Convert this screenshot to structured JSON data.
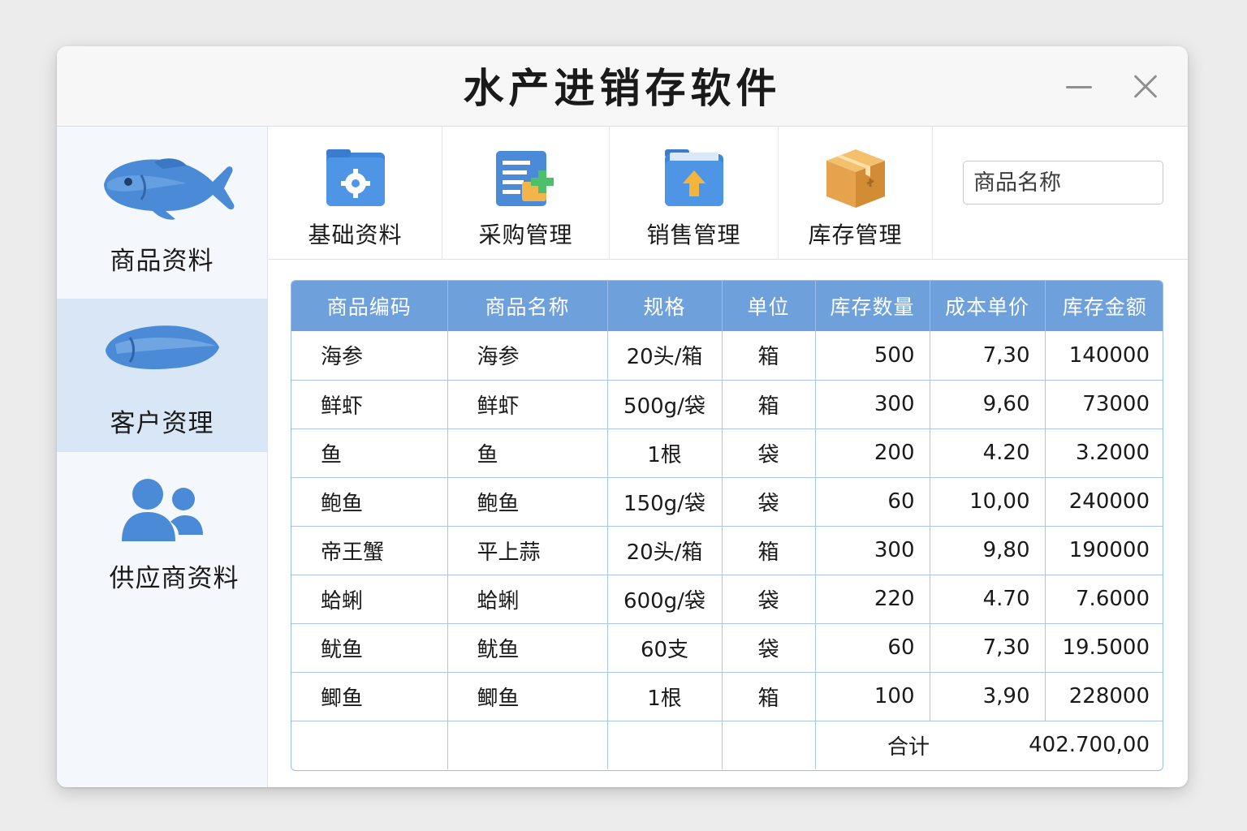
{
  "window": {
    "title": "水产进销存软件"
  },
  "sidebar": {
    "items": [
      {
        "label": "商品资料",
        "icon": "fish-icon",
        "active": false
      },
      {
        "label": "客户资理",
        "icon": "fish-fillet-icon",
        "active": true
      },
      {
        "label": "供应商资料",
        "icon": "users-icon",
        "active": false
      }
    ]
  },
  "toolbar": {
    "items": [
      {
        "label": "基础资料",
        "icon": "settings-folder-icon"
      },
      {
        "label": "采购管理",
        "icon": "document-add-icon"
      },
      {
        "label": "销售管理",
        "icon": "upload-folder-icon"
      },
      {
        "label": "库存管理",
        "icon": "box-icon"
      }
    ],
    "search_placeholder": "商品名称"
  },
  "table": {
    "headers": [
      "商品编码",
      "商品名称",
      "规格",
      "单位",
      "库存数量",
      "成本单价",
      "库存金额"
    ],
    "rows": [
      [
        "海参",
        "海参",
        "20头/箱",
        "箱",
        "500",
        "7,30",
        "140000"
      ],
      [
        "鲜虾",
        "鲜虾",
        "500g/袋",
        "箱",
        "300",
        "9,60",
        "73000"
      ],
      [
        "鱼",
        "鱼",
        "1根",
        "袋",
        "200",
        "4.20",
        "3.2000"
      ],
      [
        "鲍鱼",
        "鲍鱼",
        "150g/袋",
        "袋",
        "60",
        "10,00",
        "240000"
      ],
      [
        "帝王蟹",
        "平上蒜",
        "20头/箱",
        "箱",
        "300",
        "9,80",
        "190000"
      ],
      [
        "蛤蜊",
        "蛤蜊",
        "600g/袋",
        "袋",
        "220",
        "4.70",
        "7.6000"
      ],
      [
        "鱿鱼",
        "鱿鱼",
        "60支",
        "袋",
        "60",
        "7,30",
        "19.5000"
      ],
      [
        "鲫鱼",
        "鲫鱼",
        "1根",
        "箱",
        "100",
        "3,90",
        "228000"
      ]
    ],
    "total_label": "合计",
    "total_value": "402.700,00"
  },
  "colors": {
    "accent": "#6ea0dc",
    "icon_blue": "#4a8ad6",
    "sidebar_active": "#d8e6f6"
  }
}
